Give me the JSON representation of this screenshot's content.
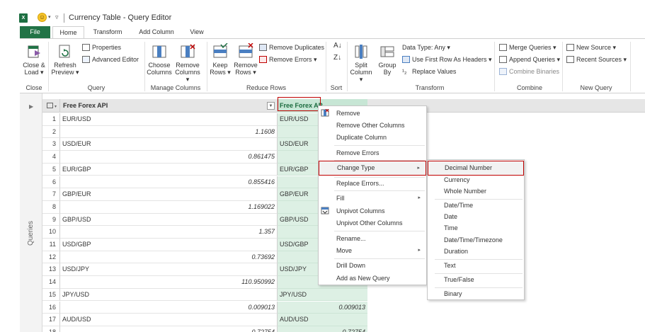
{
  "window": {
    "title": "Currency Table - Query Editor"
  },
  "tabs": [
    "File",
    "Home",
    "Transform",
    "Add Column",
    "View"
  ],
  "ribbon": {
    "close": {
      "btn": [
        "Close &",
        "Load"
      ],
      "label": "Close"
    },
    "query": {
      "refresh": [
        "Refresh",
        "Preview"
      ],
      "properties": "Properties",
      "advanced_editor": "Advanced Editor",
      "label": "Query"
    },
    "manage_columns": {
      "choose": [
        "Choose",
        "Columns"
      ],
      "remove": [
        "Remove",
        "Columns"
      ],
      "label": "Manage Columns"
    },
    "reduce_rows": {
      "keep": [
        "Keep",
        "Rows"
      ],
      "remove": [
        "Remove",
        "Rows"
      ],
      "remove_duplicates": "Remove Duplicates",
      "remove_errors": "Remove Errors",
      "label": "Reduce Rows"
    },
    "sort": {
      "label": "Sort"
    },
    "transform": {
      "split": [
        "Split",
        "Column"
      ],
      "group": [
        "Group",
        "By"
      ],
      "data_type": "Data Type: Any",
      "first_row": "Use First Row As Headers",
      "replace_values": "Replace Values",
      "label": "Transform"
    },
    "combine": {
      "merge": "Merge Queries",
      "append": "Append Queries",
      "binaries": "Combine Binaries",
      "label": "Combine"
    },
    "new_query": {
      "new_source": "New Source",
      "recent_sources": "Recent Sources",
      "label": "New Query"
    }
  },
  "queries_pane": {
    "label": "Queries"
  },
  "grid": {
    "col1_header": "Free Forex API",
    "col2_header": "Free Forex AP",
    "rows": [
      {
        "n": "1",
        "a": "EUR/USD",
        "a_num": false,
        "b": "EUR/USD",
        "b_num": false
      },
      {
        "n": "2",
        "a": "1.1608",
        "a_num": true,
        "b": "",
        "b_num": false
      },
      {
        "n": "3",
        "a": "USD/EUR",
        "a_num": false,
        "b": "USD/EUR",
        "b_num": false
      },
      {
        "n": "4",
        "a": "0.861475",
        "a_num": true,
        "b": "",
        "b_num": false
      },
      {
        "n": "5",
        "a": "EUR/GBP",
        "a_num": false,
        "b": "EUR/GBP",
        "b_num": false
      },
      {
        "n": "6",
        "a": "0.855416",
        "a_num": true,
        "b": "",
        "b_num": false
      },
      {
        "n": "7",
        "a": "GBP/EUR",
        "a_num": false,
        "b": "GBP/EUR",
        "b_num": false
      },
      {
        "n": "8",
        "a": "1.169022",
        "a_num": true,
        "b": "",
        "b_num": false
      },
      {
        "n": "9",
        "a": "GBP/USD",
        "a_num": false,
        "b": "GBP/USD",
        "b_num": false
      },
      {
        "n": "10",
        "a": "1.357",
        "a_num": true,
        "b": "",
        "b_num": false
      },
      {
        "n": "11",
        "a": "USD/GBP",
        "a_num": false,
        "b": "USD/GBP",
        "b_num": false
      },
      {
        "n": "12",
        "a": "0.73692",
        "a_num": true,
        "b": "",
        "b_num": false
      },
      {
        "n": "13",
        "a": "USD/JPY",
        "a_num": false,
        "b": "USD/JPY",
        "b_num": false
      },
      {
        "n": "14",
        "a": "110.950992",
        "a_num": true,
        "b": "",
        "b_num": false
      },
      {
        "n": "15",
        "a": "JPY/USD",
        "a_num": false,
        "b": "JPY/USD",
        "b_num": false
      },
      {
        "n": "16",
        "a": "0.009013",
        "a_num": true,
        "b": "0.009013",
        "b_num": true
      },
      {
        "n": "17",
        "a": "AUD/USD",
        "a_num": false,
        "b": "AUD/USD",
        "b_num": false
      },
      {
        "n": "18",
        "a": "0.72754",
        "a_num": true,
        "b": "0.72754",
        "b_num": true
      }
    ]
  },
  "context_menu": {
    "items": [
      "Remove",
      "Remove Other Columns",
      "Duplicate Column",
      "Remove Errors",
      "Change Type",
      "Replace Errors...",
      "Fill",
      "Unpivot Columns",
      "Unpivot Other Columns",
      "Rename...",
      "Move",
      "Drill Down",
      "Add as New Query"
    ]
  },
  "change_type_menu": {
    "items": [
      "Decimal Number",
      "Currency",
      "Whole Number",
      "Date/Time",
      "Date",
      "Time",
      "Date/Time/Timezone",
      "Duration",
      "Text",
      "True/False",
      "Binary"
    ]
  },
  "colors": {
    "accent": "#217346",
    "selected_col": "#c7e6d5",
    "highlight": "#c00000"
  }
}
